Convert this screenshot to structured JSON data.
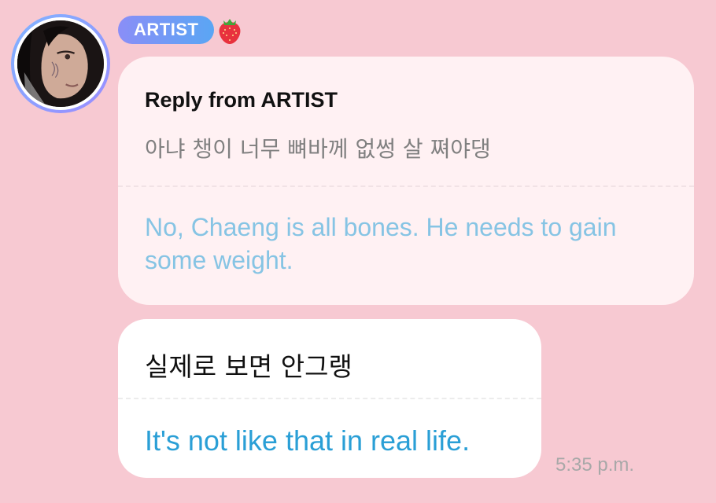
{
  "sender": {
    "badge_label": "ARTIST",
    "badge_emoji_icon": "strawberry-icon",
    "avatar": "artist-avatar"
  },
  "reply": {
    "title": "Reply from ARTIST",
    "original_text": "아냐 챙이 너무 뼈바께 없썽 살 쪄야댕",
    "translated_text": "No, Chaeng is all bones. He needs to gain some weight."
  },
  "message": {
    "original_text": "실제로 보면 안그랭",
    "translated_text": "It's not like that in real life.",
    "timestamp": "5:35 p.m."
  },
  "colors": {
    "background": "#f7c9d2",
    "reply_card": "#fff1f3",
    "message_card": "#ffffff",
    "reply_translation": "#86c4e4",
    "message_translation": "#2a9fd6",
    "badge_gradient_start": "#8a8ef7",
    "badge_gradient_end": "#5aa6f4"
  }
}
